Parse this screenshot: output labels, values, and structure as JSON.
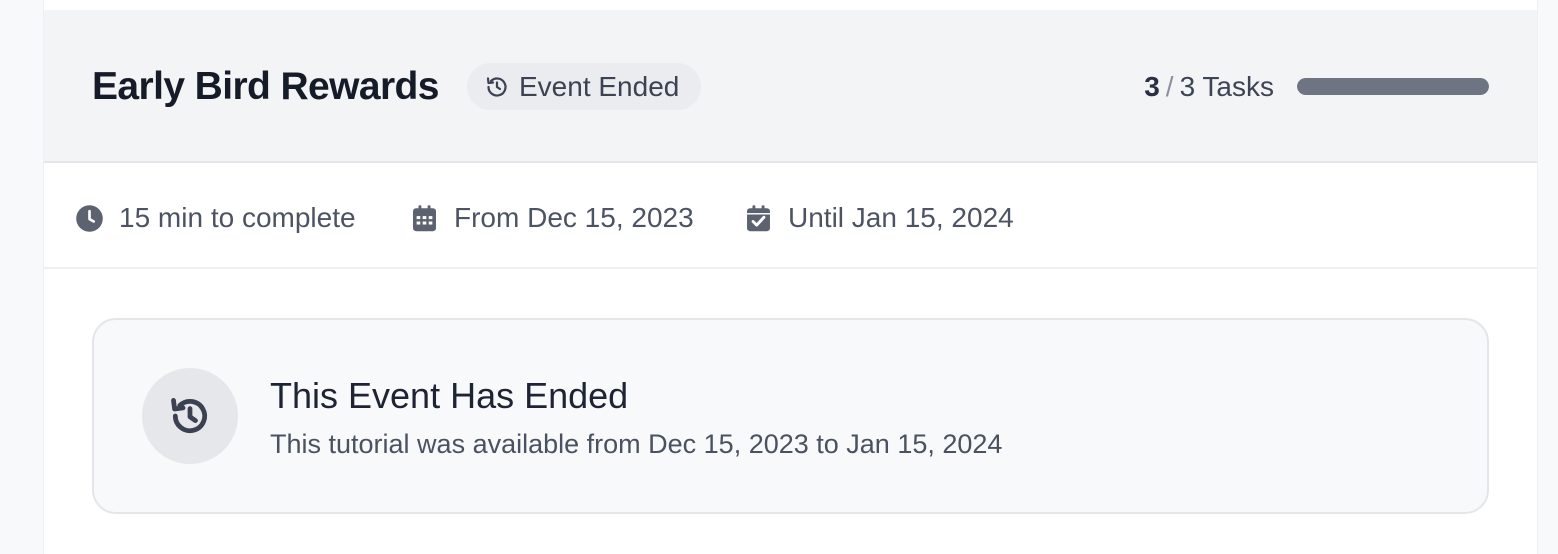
{
  "event": {
    "title": "Early Bird Rewards",
    "status_badge": "Event Ended",
    "status_icon": "history-icon"
  },
  "progress": {
    "completed": "3",
    "separator": "/",
    "total_label": "3 Tasks",
    "fraction": 1.0
  },
  "meta": {
    "duration": "15 min to complete",
    "start": "From Dec 15, 2023",
    "end": "Until Jan 15, 2024",
    "duration_icon": "clock-icon",
    "start_icon": "calendar-icon",
    "end_icon": "calendar-check-icon"
  },
  "notice": {
    "title": "This Event Has Ended",
    "description": "This tutorial was available from Dec 15, 2023 to Jan 15, 2024",
    "icon": "history-icon"
  },
  "colors": {
    "accent_progress": "#6f7482",
    "header_bg": "#f3f4f6",
    "notice_bg": "#f8f9fa"
  }
}
